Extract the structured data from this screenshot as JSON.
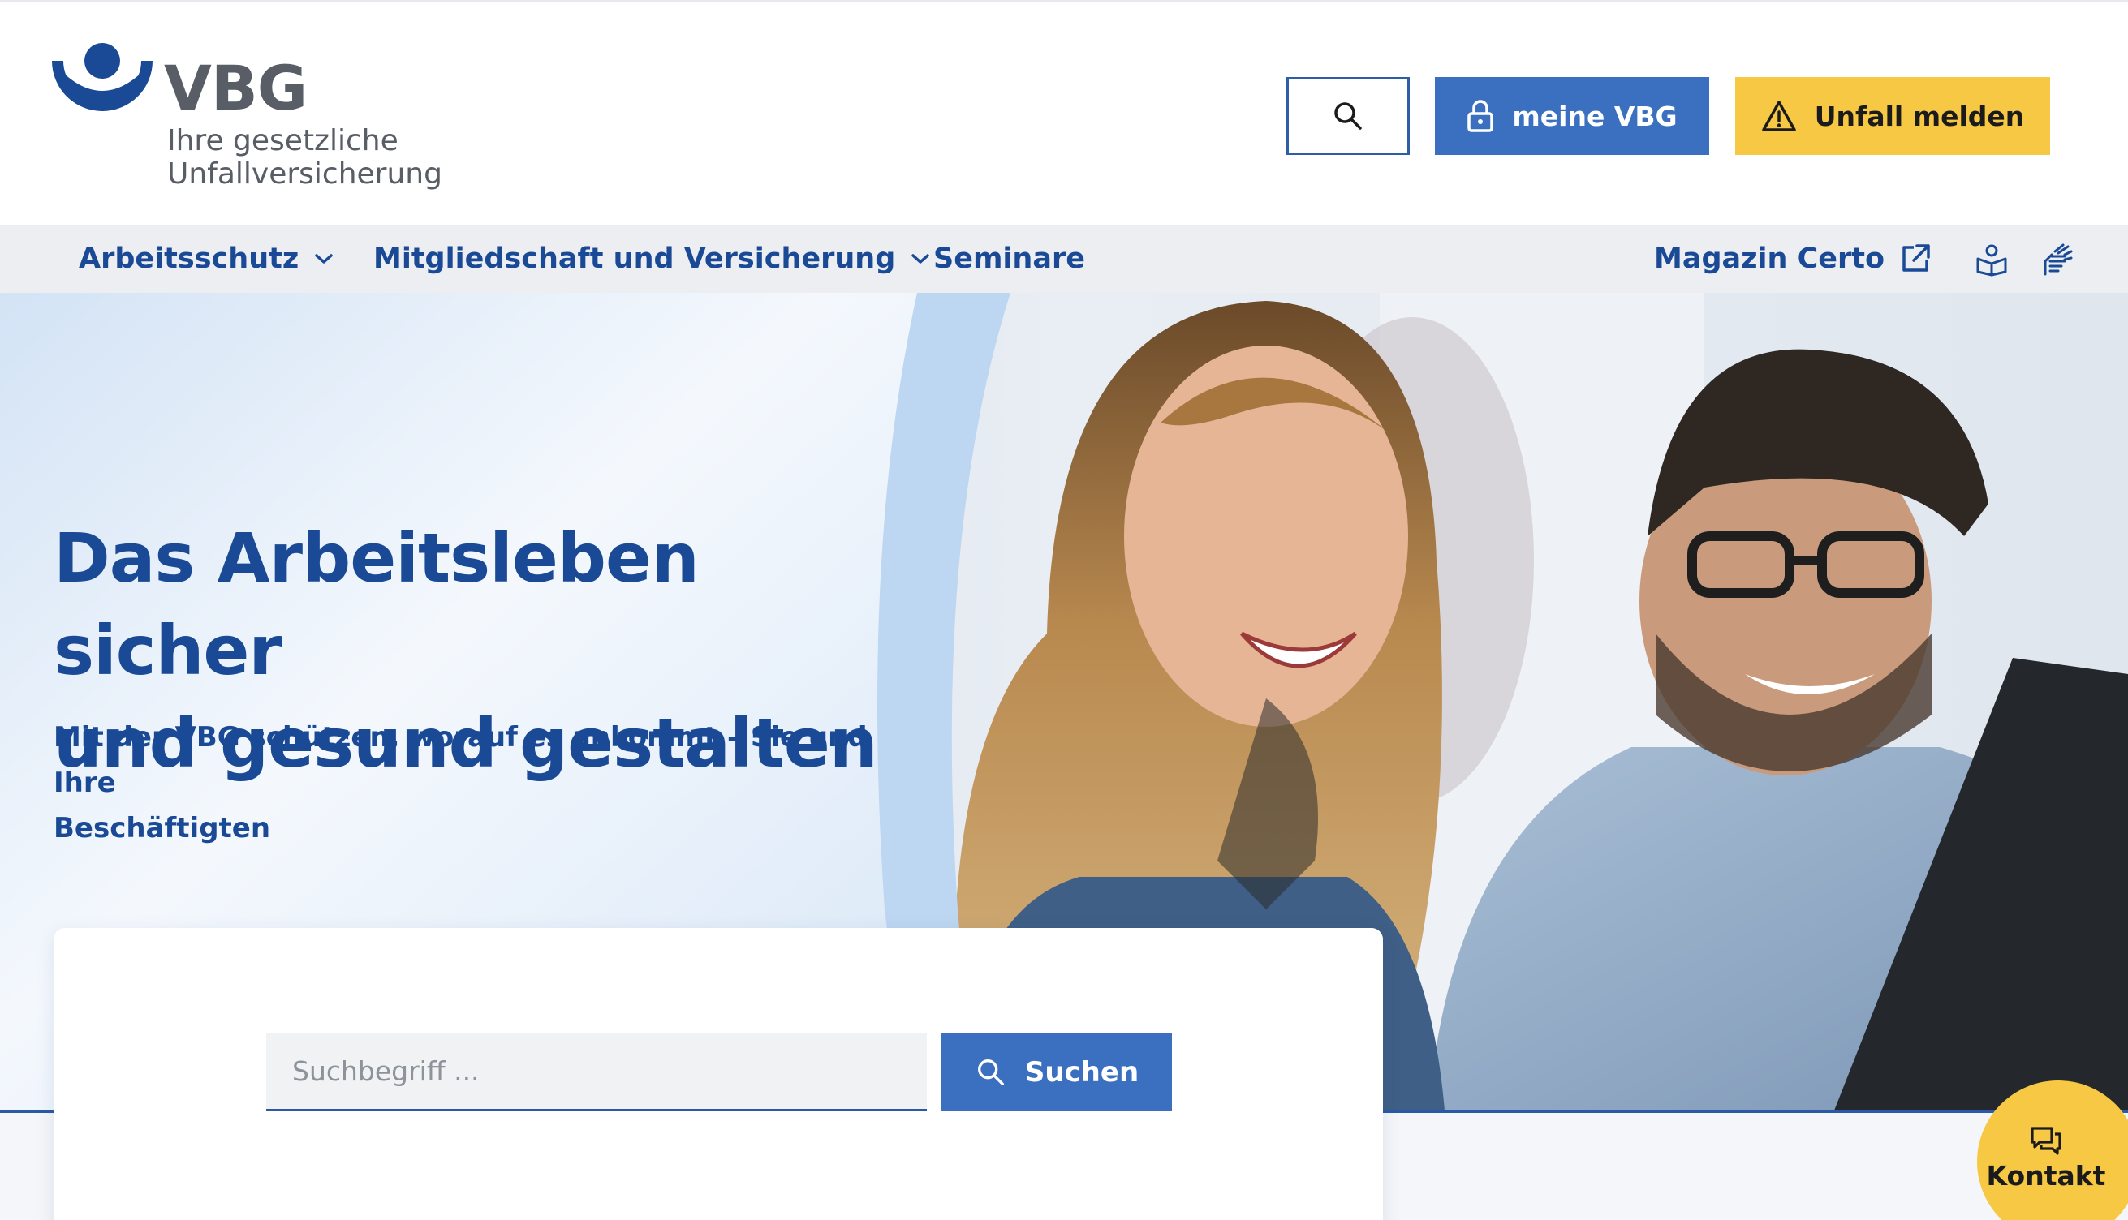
{
  "brand": {
    "name": "VBG",
    "tagline_line1": "Ihre gesetzliche",
    "tagline_line2": "Unfallversicherung",
    "blue": "#1a4a96",
    "button_blue": "#3a70bf",
    "yellow": "#f6c843"
  },
  "header": {
    "search_icon": "search-icon",
    "meine_label": "meine VBG",
    "meine_icon": "lock-icon",
    "unfall_label": "Unfall melden",
    "unfall_icon": "warning-triangle-icon"
  },
  "nav": {
    "items": [
      {
        "label": "Arbeitsschutz",
        "icon": "chevron-down-icon"
      },
      {
        "label": "Mitgliedschaft und Versicherung",
        "icon": "chevron-down-icon"
      },
      {
        "label": "Seminare"
      }
    ],
    "magazin_label": "Magazin Certo",
    "magazin_icon": "external-link-icon",
    "accessibility_icons": [
      "easy-language-icon",
      "sign-language-icon"
    ]
  },
  "hero": {
    "headline_line1": "Das Arbeitsleben sicher",
    "headline_line2": "und gesund gestalten",
    "subline_line1": "Mit der VBG schützen, worauf es ankommt – Sie und Ihre",
    "subline_line2": "Beschäftigten"
  },
  "search": {
    "placeholder": "Suchbegriff ...",
    "button_label": "Suchen"
  },
  "contact": {
    "label": "Kontakt",
    "icon": "chat-icon"
  }
}
